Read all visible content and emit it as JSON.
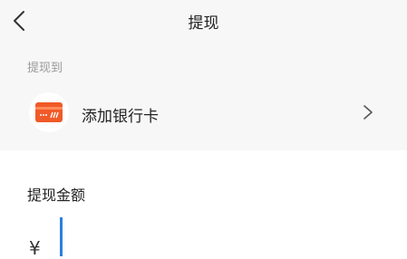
{
  "header": {
    "title": "提现",
    "back_icon": "chevron-left-icon"
  },
  "withdraw_to": {
    "label": "提现到",
    "add_card_label": "添加银行卡",
    "card_icon": "bank-card-icon",
    "card_icon_color": "#f05a28",
    "arrow_icon": "chevron-right-icon"
  },
  "amount": {
    "label": "提现金额",
    "currency_symbol": "¥",
    "value": ""
  },
  "colors": {
    "top_background": "#f7f7f7",
    "cursor": "#2a7fe0",
    "muted_text": "#9a9a9a"
  }
}
